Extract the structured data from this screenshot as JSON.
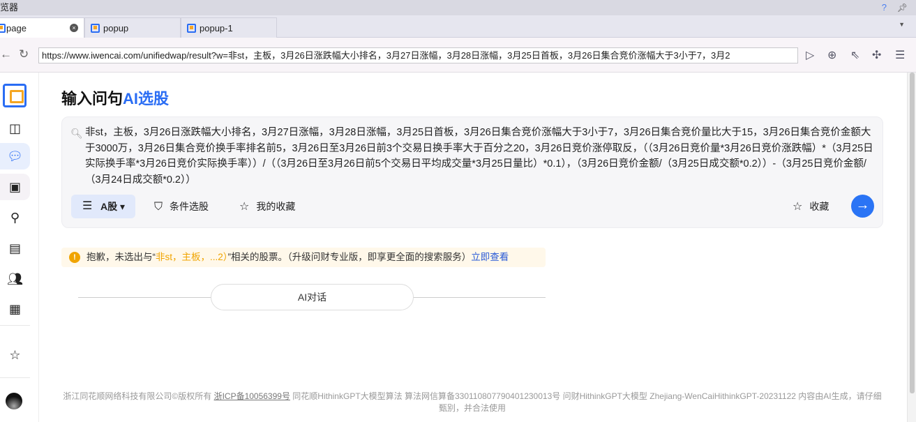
{
  "window": {
    "title": "览器",
    "help": "?",
    "pin": "⊥"
  },
  "tabs": [
    {
      "label": "page",
      "active": true
    },
    {
      "label": "popup"
    },
    {
      "label": "popup-1"
    }
  ],
  "address": {
    "url": "https://www.iwencai.com/unifiedwap/result?w=非st，主板，3月26日涨跌幅大小排名，3月27日涨幅，3月28日涨幅，3月25日首板，3月26日集合竞价涨幅大于3小于7，3月2"
  },
  "page": {
    "heading_pre": "输入问句",
    "heading_ai": "AI选股",
    "query": "非st，主板，3月26日涨跌幅大小排名，3月27日涨幅，3月28日涨幅，3月25日首板，3月26日集合竞价涨幅大于3小于7，3月26日集合竞价量比大于15，3月26日集合竞价金额大于3000万，3月26日集合竞价换手率排名前5，3月26日至3月26日前3个交易日换手率大于百分之20，3月26日竞价涨停取反，（（3月26日竞价量*3月26日竞价涨跌幅）*（3月25日实际换手率*3月26日竞价实际换手率））/（（3月26日至3月26日前5个交易日平均成交量*3月25日量比）*0.1），（3月26日竞价金额/（3月25日成交额*0.2））-（3月25日竞价金额/（3月24日成交额*0.2））",
    "market_label": "A股",
    "filter_label": "条件选股",
    "favorites_label": "我的收藏",
    "collect_label": "收藏",
    "notice": {
      "pre": "抱歉，未选出与“",
      "hl": "非st，主板，...2）",
      "post": "”相关的股票。（升级问财专业版，即享更全面的搜索服务）",
      "link": "立即查看"
    },
    "ai_chat": "AI对话",
    "footer": {
      "company": "浙江同花顺网络科技有限公司©版权所有 ",
      "icp": "浙ICP备10056399号",
      "rest": " 同花顺HithinkGPT大模型算法 算法网信算备330110807790401230013号 问财HithinkGPT大模型 Zhejiang-WenCaiHithinkGPT-20231122 内容由AI生成，请仔细甄别，并合法使用"
    }
  },
  "colors": {
    "accent": "#2a6df4",
    "warning": "#f0a400"
  }
}
